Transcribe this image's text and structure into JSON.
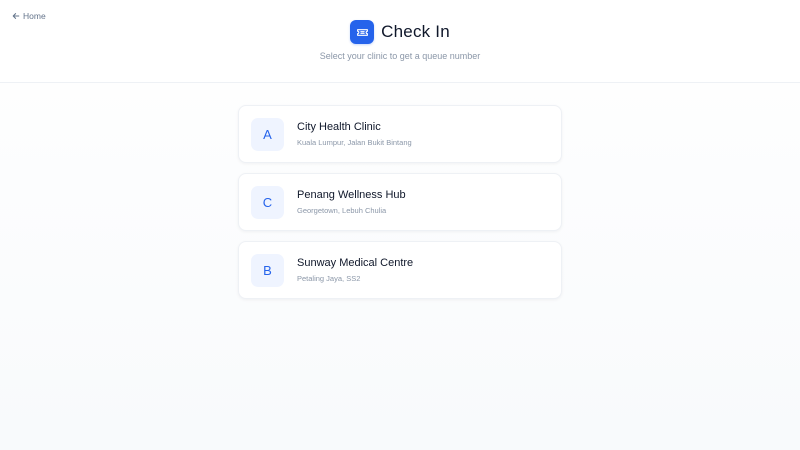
{
  "nav": {
    "home_label": "Home",
    "back_icon": "arrow-left-icon"
  },
  "header": {
    "title": "Check In",
    "subtitle": "Select your clinic to get a queue number",
    "title_icon": "ticket-icon"
  },
  "colors": {
    "accent": "#2563eb",
    "avatar_bg": "#eff4ff"
  },
  "clinics": [
    {
      "letter": "A",
      "name": "City Health Clinic",
      "address": "Kuala Lumpur, Jalan Bukit Bintang"
    },
    {
      "letter": "C",
      "name": "Penang Wellness Hub",
      "address": "Georgetown, Lebuh Chulia"
    },
    {
      "letter": "B",
      "name": "Sunway Medical Centre",
      "address": "Petaling Jaya, SS2"
    }
  ]
}
